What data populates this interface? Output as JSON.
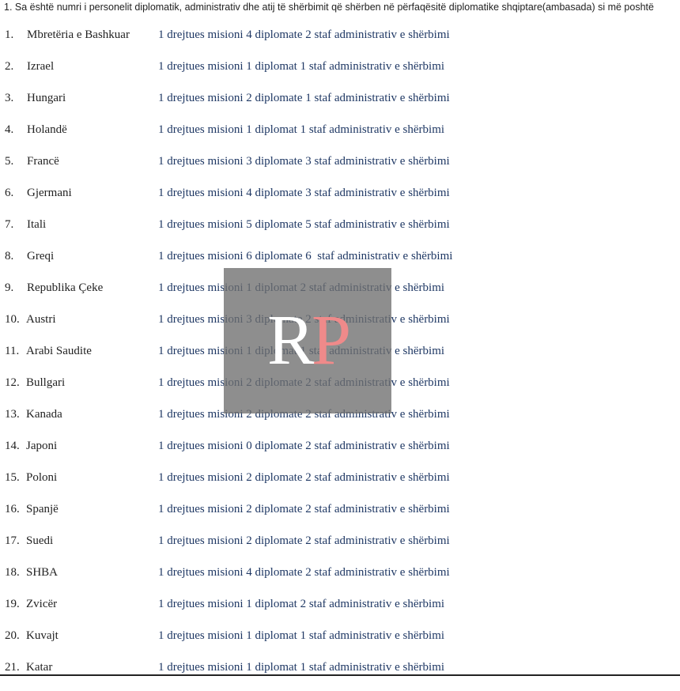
{
  "question": "1. Sa është numri i personelit diplomatik, administrativ dhe atij të shërbimit që shërben në përfaqësitë diplomatike shqiptare(ambasada) si më poshtë",
  "watermark": {
    "letter1": "R",
    "letter2": "P"
  },
  "rows": [
    {
      "num": "1.",
      "country": "Mbretëria e Bashkuar",
      "staff": "1 drejtues misioni 4 diplomate 2 staf administrativ e shërbimi"
    },
    {
      "num": "2.",
      "country": "Izrael",
      "staff": "1 drejtues misioni 1 diplomat 1 staf administrativ e shërbimi"
    },
    {
      "num": "3.",
      "country": "Hungari",
      "staff": "1 drejtues misioni 2 diplomate 1 staf administrativ e shërbimi"
    },
    {
      "num": "4.",
      "country": "Holandë",
      "staff": "1 drejtues misioni 1 diplomat 1 staf administrativ e shërbimi"
    },
    {
      "num": "5.",
      "country": "Francë",
      "staff": "1 drejtues misioni 3 diplomate 3 staf administrativ e shërbimi"
    },
    {
      "num": "6.",
      "country": "Gjermani",
      "staff": "1 drejtues misioni 4 diplomate 3 staf administrativ e shërbimi"
    },
    {
      "num": "7.",
      "country": "Itali",
      "staff": "1 drejtues misioni 5 diplomate 5 staf administrativ e shërbimi"
    },
    {
      "num": "8.",
      "country": "Greqi",
      "staff": "1 drejtues misioni 6 diplomate 6  staf administrativ e shërbimi"
    },
    {
      "num": "9.",
      "country": "Republika Çeke",
      "staff": "1 drejtues misioni 1 diplomat 2 staf administrativ e shërbimi"
    },
    {
      "num": "10.",
      "country": "Austri",
      "staff": "1 drejtues misioni 3 diplomate 2 staf administrativ e shërbimi"
    },
    {
      "num": "11.",
      "country": "Arabi Saudite",
      "staff": "1 drejtues misioni 1 diplomat 1 staf administrativ e shërbimi"
    },
    {
      "num": "12.",
      "country": "Bullgari",
      "staff": "1 drejtues misioni 2 diplomate 2 staf administrativ e shërbimi"
    },
    {
      "num": "13.",
      "country": "Kanada",
      "staff": "1 drejtues misioni 2 diplomate 2 staf administrativ e shërbimi"
    },
    {
      "num": "14.",
      "country": "Japoni",
      "staff": "1 drejtues misioni 0 diplomate 2 staf administrativ e shërbimi"
    },
    {
      "num": "15.",
      "country": "Poloni",
      "staff": "1 drejtues misioni 2 diplomate 2 staf administrativ e shërbimi"
    },
    {
      "num": "16.",
      "country": "Spanjë",
      "staff": "1 drejtues misioni 2 diplomate 2 staf administrativ e shërbimi"
    },
    {
      "num": "17.",
      "country": "Suedi",
      "staff": "1 drejtues misioni 2 diplomate 2 staf administrativ e shërbimi"
    },
    {
      "num": "18.",
      "country": "SHBA",
      "staff": "1 drejtues misioni 4 diplomate 2 staf administrativ e shërbimi"
    },
    {
      "num": "19.",
      "country": "Zvicër",
      "staff": "1 drejtues misioni 1 diplomat 2 staf administrativ e shërbimi"
    },
    {
      "num": "20.",
      "country": "Kuvajt",
      "staff": "1 drejtues misioni 1 diplomat 1 staf administrativ e shërbimi"
    },
    {
      "num": "21.",
      "country": "Katar",
      "staff": "1 drejtues misioni 1 diplomat 1 staf administrativ e shërbimi"
    }
  ]
}
